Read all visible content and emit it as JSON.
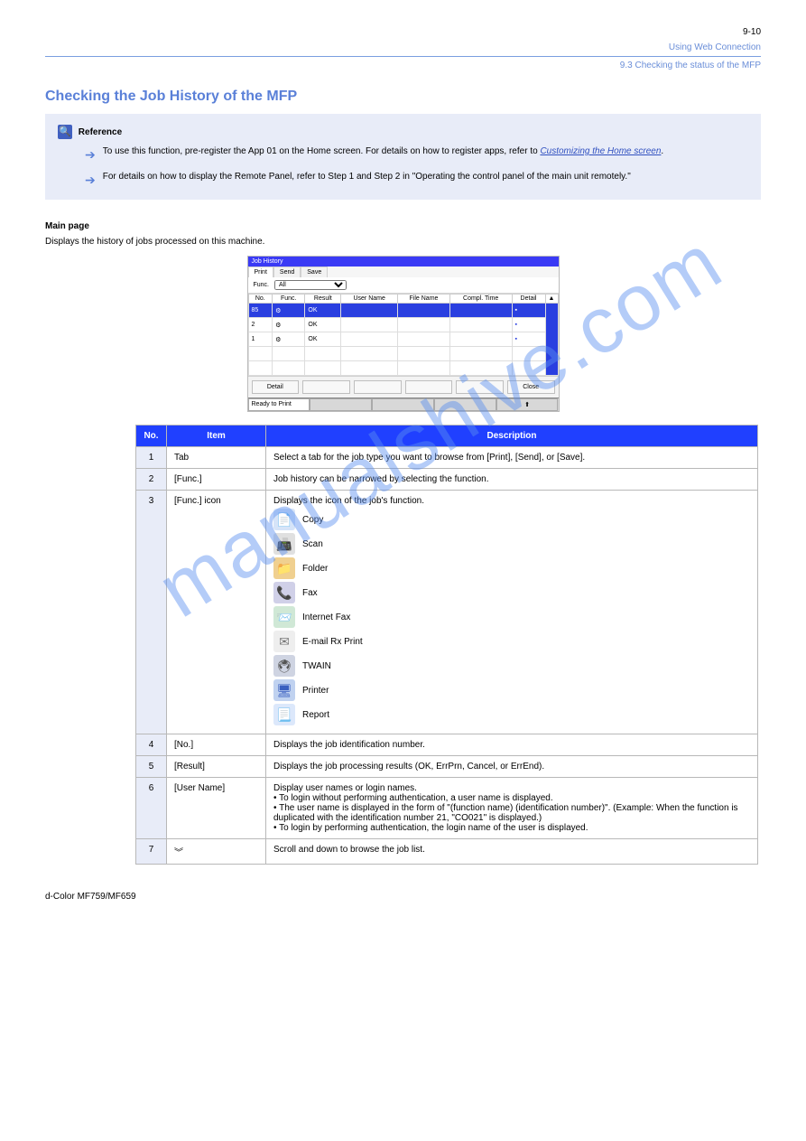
{
  "header": {
    "page_num": "9-10",
    "line1": "Using Web Connection",
    "line2": "9.3 Checking the status of the MFP"
  },
  "section_title": "Checking the Job History of the MFP",
  "callout": {
    "title": "Reference",
    "p1_prefix": "To use this function, pre-register the App 01 on the Home screen. For details on how to register apps, refer to ",
    "ref": "Customizing the Home screen",
    "p1_suffix": ".",
    "p2": "For details on how to display the Remote Panel, refer to Step 1 and Step 2 in \"Operating the control panel of the main unit remotely.\""
  },
  "subsection": "Main page",
  "subdesc": "Displays the history of jobs processed on this machine.",
  "appshot": {
    "title": "Job History",
    "tabs": [
      "Print",
      "Send",
      "Save"
    ],
    "filter_label": "Func.",
    "filter_value": "All",
    "cols": [
      "No.",
      "Func.",
      "Result",
      "User Name",
      "File Name",
      "Compl. Time",
      "Detail"
    ],
    "rows": [
      {
        "no": "85",
        "result": "OK",
        "user": "",
        "file": "",
        "time": "",
        "sel": true
      },
      {
        "no": "2",
        "result": "OK",
        "user": "",
        "file": "",
        "time": "",
        "sel": false
      },
      {
        "no": "1",
        "result": "OK",
        "user": "",
        "file": "",
        "time": "",
        "sel": false
      }
    ],
    "buttons": [
      "Detail",
      "",
      "",
      "",
      "",
      "Close"
    ],
    "status": [
      "Ready to Print",
      "",
      "",
      "",
      ""
    ]
  },
  "table": {
    "headers": [
      "No.",
      "Item",
      "Description"
    ],
    "rows": [
      {
        "no": "1",
        "item": "Tab",
        "desc": "Select a tab for the job type you want to browse from [Print], [Send], or [Save]."
      },
      {
        "no": "2",
        "item": "[Func.]",
        "desc": "Job history can be narrowed by selecting the function."
      },
      {
        "no": "3",
        "item": "[Func.] icon",
        "desc_lead": "Displays the icon of the job's function.",
        "icons": [
          {
            "cls": "fi-copy",
            "glyph": "📄",
            "label": "Copy"
          },
          {
            "cls": "fi-scan",
            "glyph": "📠",
            "label": "Scan"
          },
          {
            "cls": "fi-fold",
            "glyph": "📁",
            "label": "Folder"
          },
          {
            "cls": "fi-fax",
            "glyph": "📞",
            "label": "Fax"
          },
          {
            "cls": "fi-ifax",
            "glyph": "📨",
            "label": "Internet Fax"
          },
          {
            "cls": "fi-mail",
            "glyph": "✉",
            "label": "E-mail Rx Print"
          },
          {
            "cls": "fi-twain",
            "glyph": "🖲",
            "label": "TWAIN"
          },
          {
            "cls": "fi-prn",
            "glyph": "🖥",
            "label": "Printer"
          },
          {
            "cls": "fi-rep",
            "glyph": "📃",
            "label": "Report"
          }
        ]
      },
      {
        "no": "4",
        "item": "[No.]",
        "desc": "Displays the job identification number."
      },
      {
        "no": "5",
        "item": "[Result]",
        "desc": "Displays the job processing results (OK, ErrPrn, Cancel, or ErrEnd)."
      },
      {
        "no": "6",
        "item": "[User Name]",
        "desc_multi": [
          "Display user names or login names.",
          "• To login without performing authentication, a user name is displayed.",
          "• The user name is displayed in the form of \"(function name) (identification number)\". (Example: When the function is duplicated with the identification number 21, \"CO021\" is displayed.)",
          "• To login by performing authentication, the login name of the user is displayed."
        ]
      },
      {
        "no": "7",
        "item": "",
        "chev": true,
        "desc": "Scroll and down to browse the job list."
      }
    ]
  },
  "footer": "d-Color MF759/MF659",
  "watermark": "manualshive.com"
}
